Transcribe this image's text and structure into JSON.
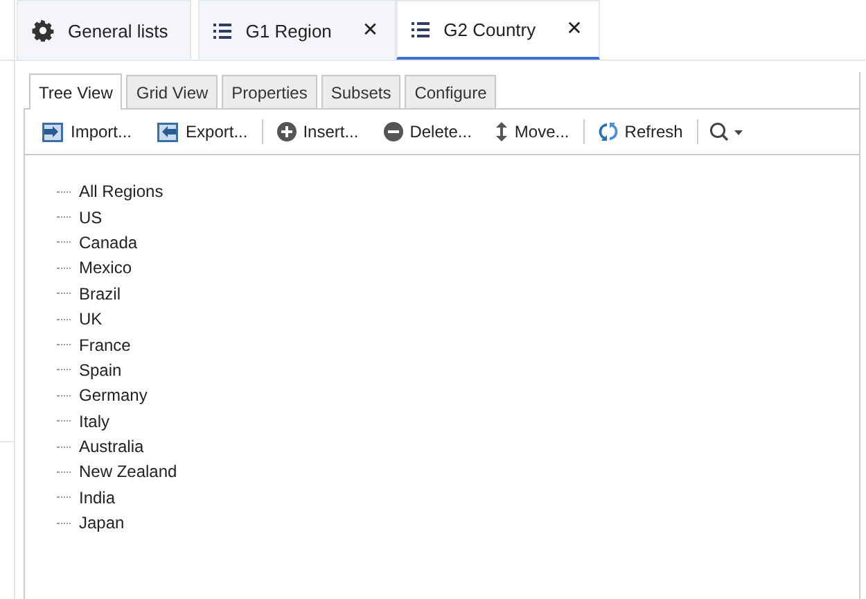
{
  "main_tabs": [
    {
      "label": "General lists",
      "selected": false,
      "closable": false
    },
    {
      "label": "G1 Region",
      "selected": false,
      "closable": true
    },
    {
      "label": "G2 Country",
      "selected": true,
      "closable": true
    }
  ],
  "close_glyph": "✕",
  "view_tabs": [
    {
      "label": "Tree View",
      "selected": true
    },
    {
      "label": "Grid View",
      "selected": false
    },
    {
      "label": "Properties",
      "selected": false
    },
    {
      "label": "Subsets",
      "selected": false
    },
    {
      "label": "Configure",
      "selected": false
    }
  ],
  "toolbar": {
    "groups": [
      [
        "Import...",
        "Export..."
      ],
      [
        "Insert...",
        "Delete...",
        "Move..."
      ],
      [
        "Refresh"
      ]
    ]
  },
  "tree": {
    "items": [
      "All Regions",
      "US",
      "Canada",
      "Mexico",
      "Brazil",
      "UK",
      "France",
      "Spain",
      "Germany",
      "Italy",
      "Australia",
      "New Zealand",
      "India",
      "Japan"
    ]
  }
}
